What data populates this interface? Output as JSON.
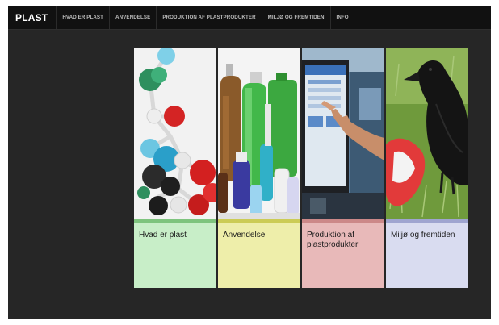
{
  "nav": {
    "brand": "PLAST",
    "items": [
      {
        "label": "HVAD ER PLAST"
      },
      {
        "label": "ANVENDELSE"
      },
      {
        "label": "PRODUKTION AF PLASTPRODUKTER"
      },
      {
        "label": "MILJØ OG FREMTIDEN"
      },
      {
        "label": "INFO"
      }
    ]
  },
  "tiles": [
    {
      "label": "Hvad er plast",
      "caption_color": "#c8eec8",
      "stripe_color": "#7ec47e",
      "image": "molecule-model"
    },
    {
      "label": "Anvendelse",
      "caption_color": "#eeeeaa",
      "stripe_color": "#cccc55",
      "image": "plastic-bottles"
    },
    {
      "label": "Produktion af plastprodukter",
      "caption_color": "#e8b9b9",
      "stripe_color": "#cc8888",
      "image": "touchscreen-machine"
    },
    {
      "label": "Miljø og fremtiden",
      "caption_color": "#d9dcf0",
      "stripe_color": "#9fa5d0",
      "image": "crow-with-plastic-bag"
    }
  ]
}
